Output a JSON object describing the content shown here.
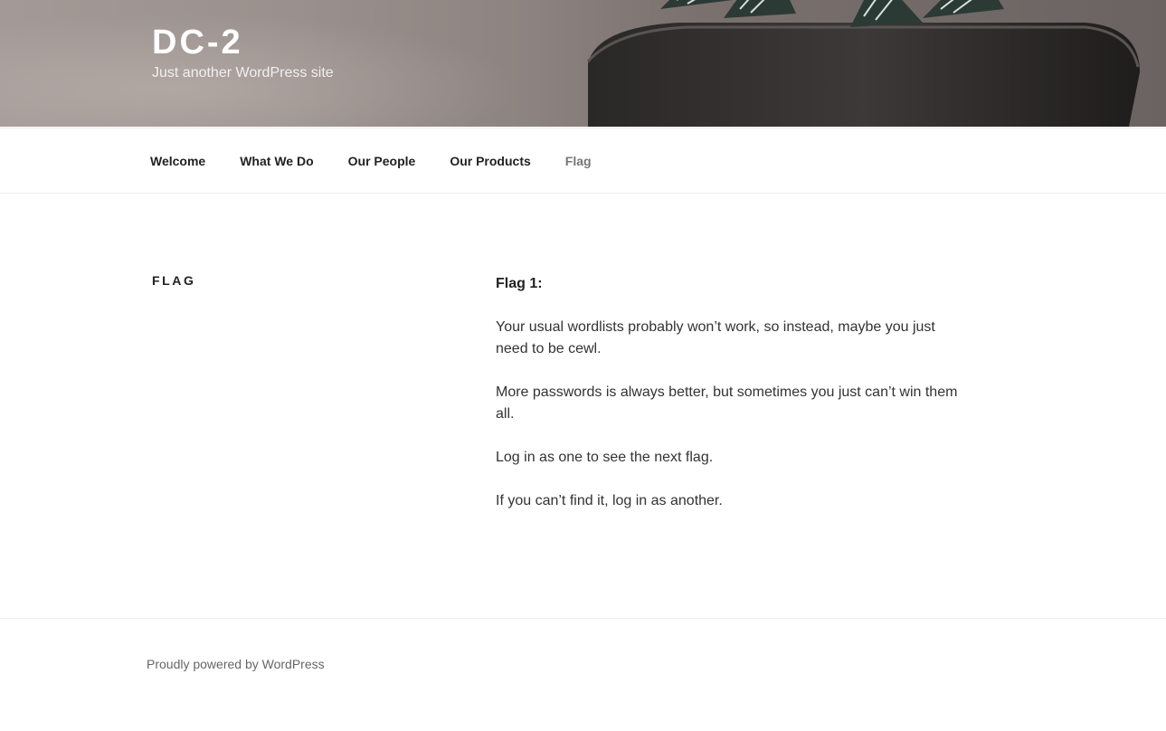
{
  "site": {
    "title": "DC-2",
    "description": "Just another WordPress site"
  },
  "nav": {
    "items": [
      {
        "label": "Welcome"
      },
      {
        "label": "What We Do"
      },
      {
        "label": "Our People"
      },
      {
        "label": "Our Products"
      },
      {
        "label": "Flag",
        "current": true
      }
    ]
  },
  "page": {
    "title": "FLAG",
    "heading": "Flag 1:",
    "paragraphs": [
      "Your usual wordlists probably won’t work, so instead, maybe you just need to be cewl.",
      "More passwords is always better, but sometimes you just can’t win them all.",
      "Log in as one to see the next flag.",
      "If you can’t find it, log in as another."
    ]
  },
  "footer": {
    "powered_by": "Proudly powered by WordPress"
  },
  "colors": {
    "nav_current": "#767676",
    "text": "#333333",
    "header_overlay": "#ffffff"
  }
}
